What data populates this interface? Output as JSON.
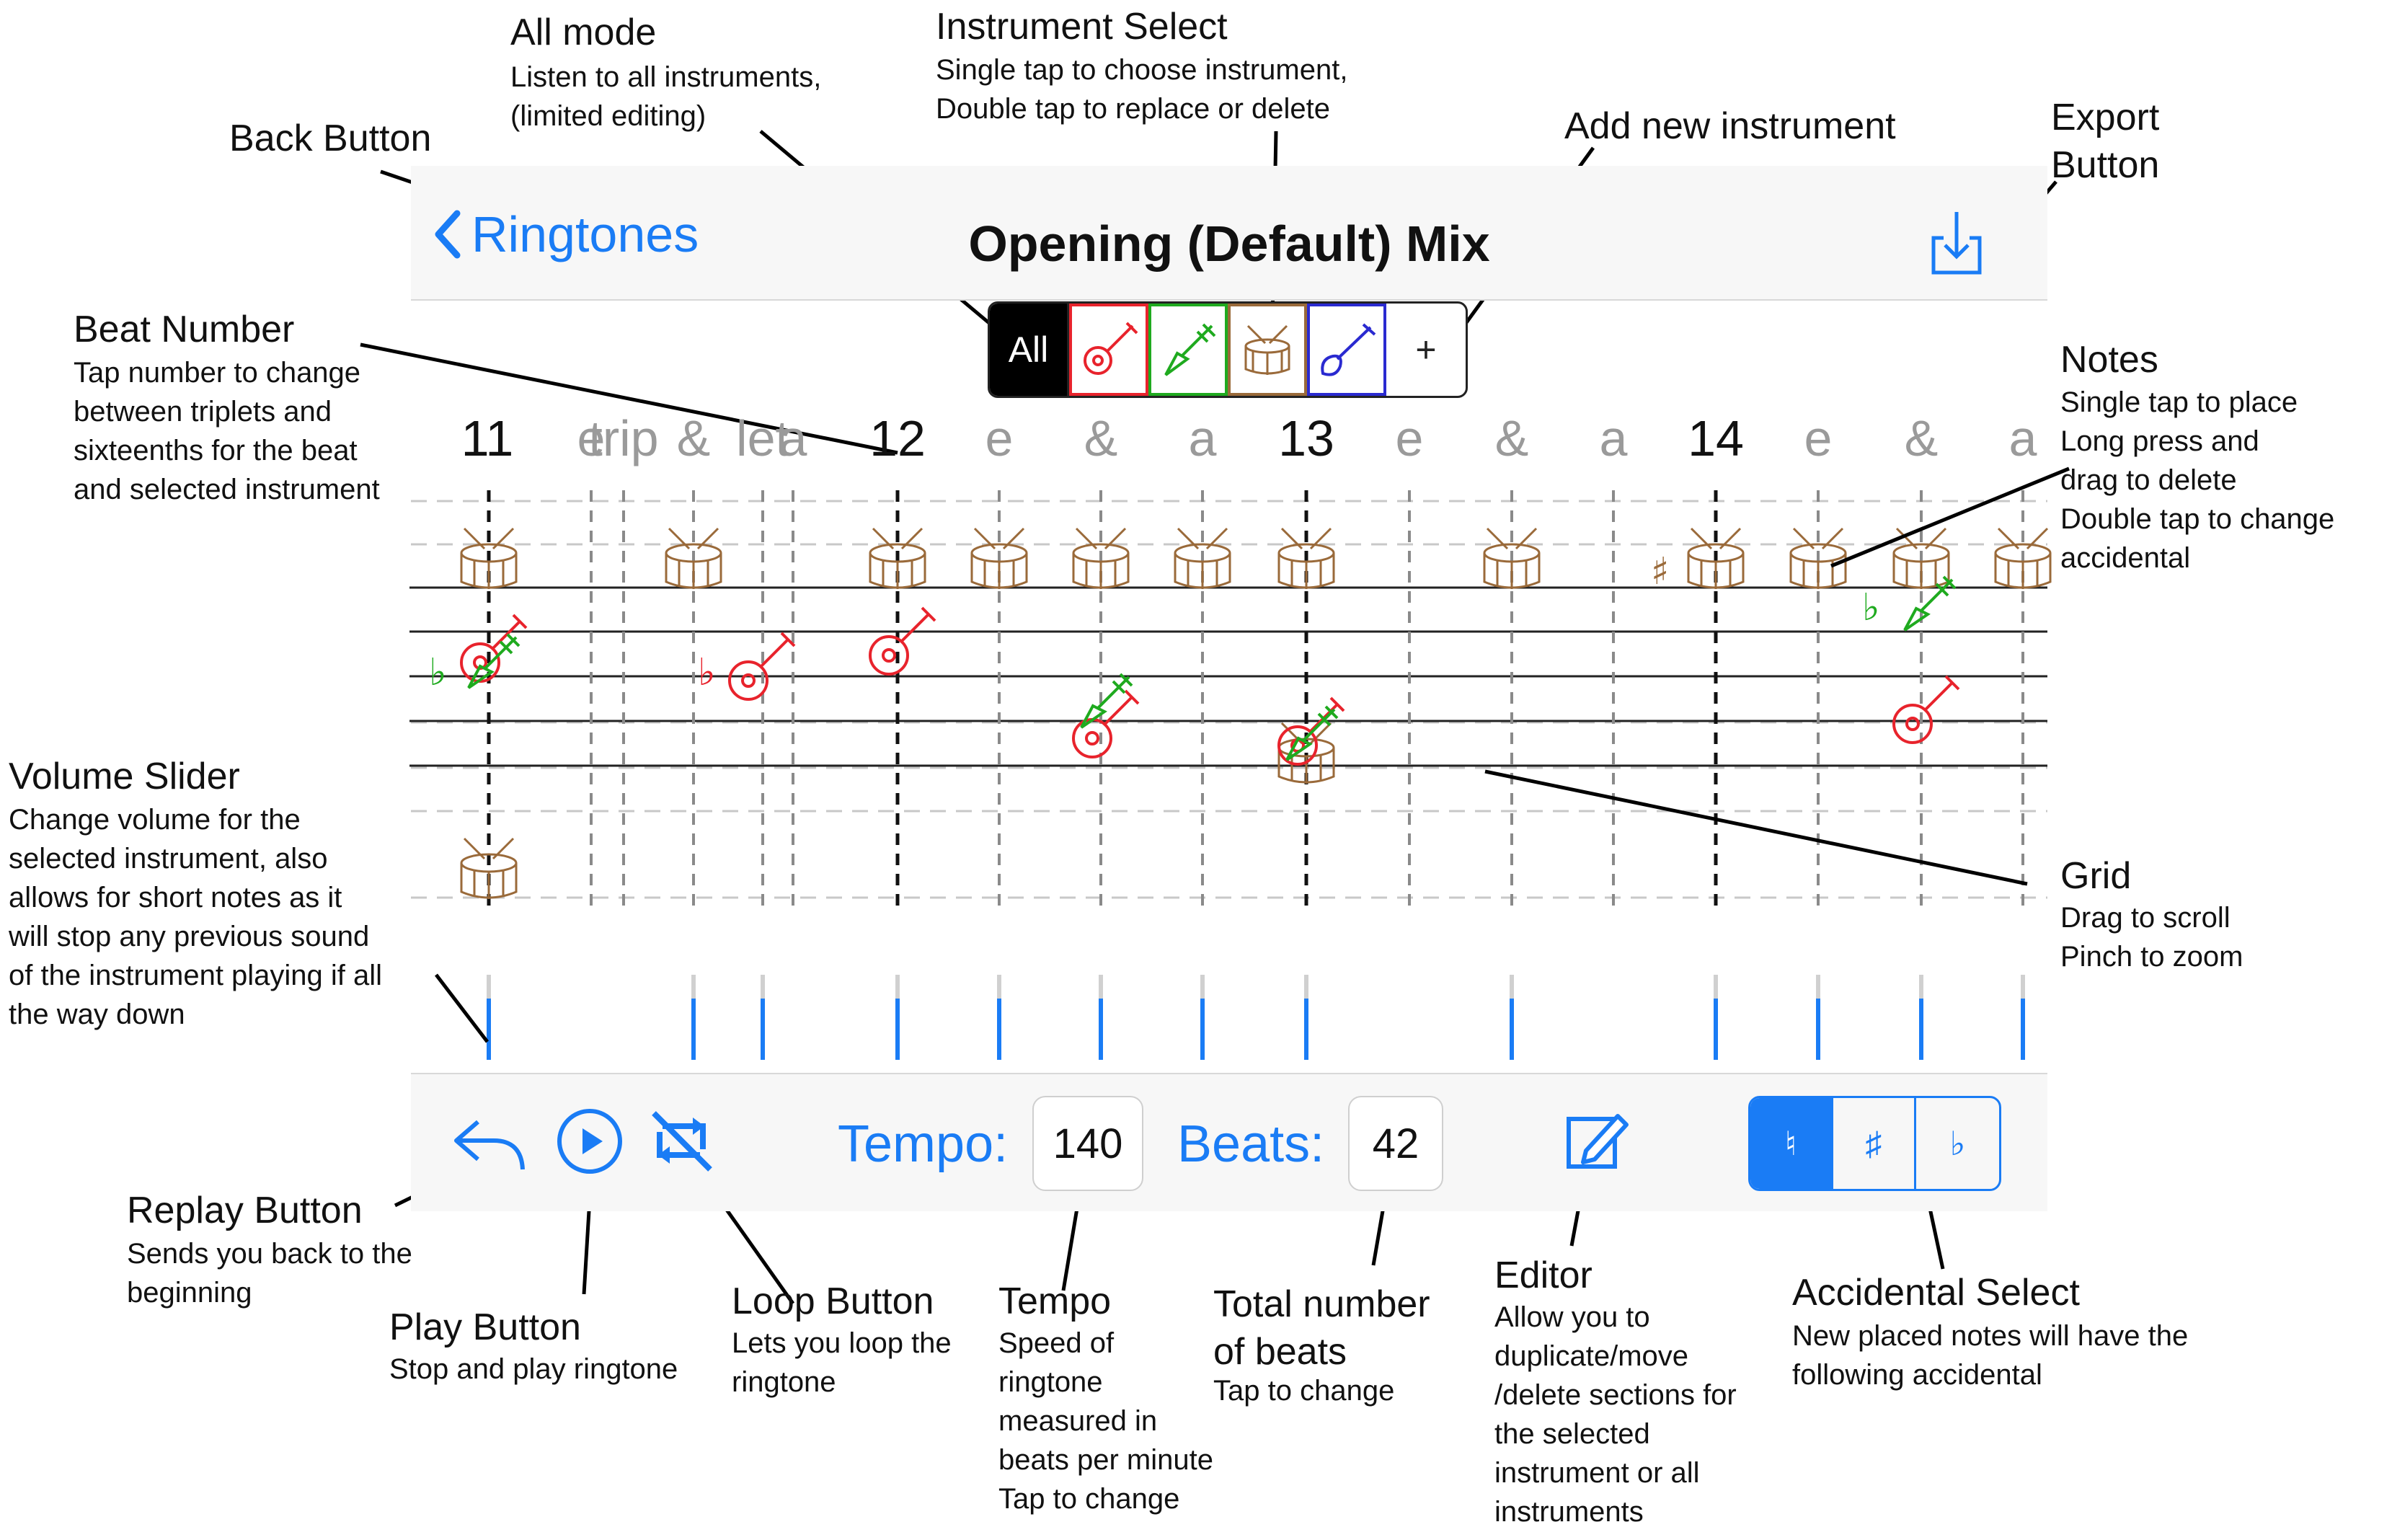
{
  "annotations": {
    "all_mode": {
      "title": "All mode",
      "desc": "Listen to all instruments,\n(limited editing)"
    },
    "instrument_select": {
      "title": "Instrument Select",
      "desc": "Single tap to choose instrument,\nDouble tap to replace or delete"
    },
    "back_button": {
      "title": "Back Button"
    },
    "add_instrument": {
      "title": "Add new instrument"
    },
    "export_button": {
      "title": "Export\nButton"
    },
    "beat_number": {
      "title": "Beat Number",
      "desc": "Tap number to change\nbetween triplets and\nsixteenths for the beat\nand selected instrument"
    },
    "notes": {
      "title": "Notes",
      "desc": "Single tap to place\nLong press and\ndrag to delete\nDouble tap to change\naccidental"
    },
    "volume_slider": {
      "title": "Volume Slider",
      "desc": "Change volume for the\nselected instrument, also\nallows for short notes as it\nwill stop any previous sound\nof the instrument playing if all\nthe way down"
    },
    "grid": {
      "title": "Grid",
      "desc": "Drag to scroll\nPinch to zoom"
    },
    "replay_button": {
      "title": "Replay Button",
      "desc": "Sends you back to the\nbeginning"
    },
    "play_button": {
      "title": "Play Button",
      "desc": "Stop and play ringtone"
    },
    "loop_button": {
      "title": "Loop Button",
      "desc": "Lets you loop the\nringtone"
    },
    "tempo": {
      "title": "Tempo",
      "desc": "Speed of\nringtone\nmeasured in\nbeats per minute\nTap to change"
    },
    "total_beats": {
      "title": "Total number\nof beats",
      "desc": "Tap to change"
    },
    "editor": {
      "title": "Editor",
      "desc": "Allow you to\nduplicate/move\n/delete sections for\nthe selected\ninstrument or all\ninstruments"
    },
    "accidental_select": {
      "title": "Accidental Select",
      "desc": "New placed notes will have the\nfollowing accidental"
    }
  },
  "nav": {
    "back_label": "Ringtones",
    "title": "Opening (Default) Mix"
  },
  "instruments": {
    "all_label": "All",
    "add_label": "+"
  },
  "beat_labels": [
    "11",
    "e",
    "trip",
    "&",
    "let",
    "a",
    "12",
    "e",
    "&",
    "a",
    "13",
    "e",
    "&",
    "a",
    "14",
    "e",
    "&",
    "a"
  ],
  "toolbar": {
    "tempo_label": "Tempo:",
    "tempo_value": "140",
    "beats_label": "Beats:",
    "beats_value": "42",
    "accidentals": [
      "♮",
      "♯",
      "♭"
    ],
    "selected_accidental": "♮"
  },
  "colors": {
    "accent": "#1a7cf5",
    "guitar": "#e8232c",
    "bass": "#1faa1f",
    "drum": "#9a6a3a",
    "electric": "#2a2ad0"
  }
}
